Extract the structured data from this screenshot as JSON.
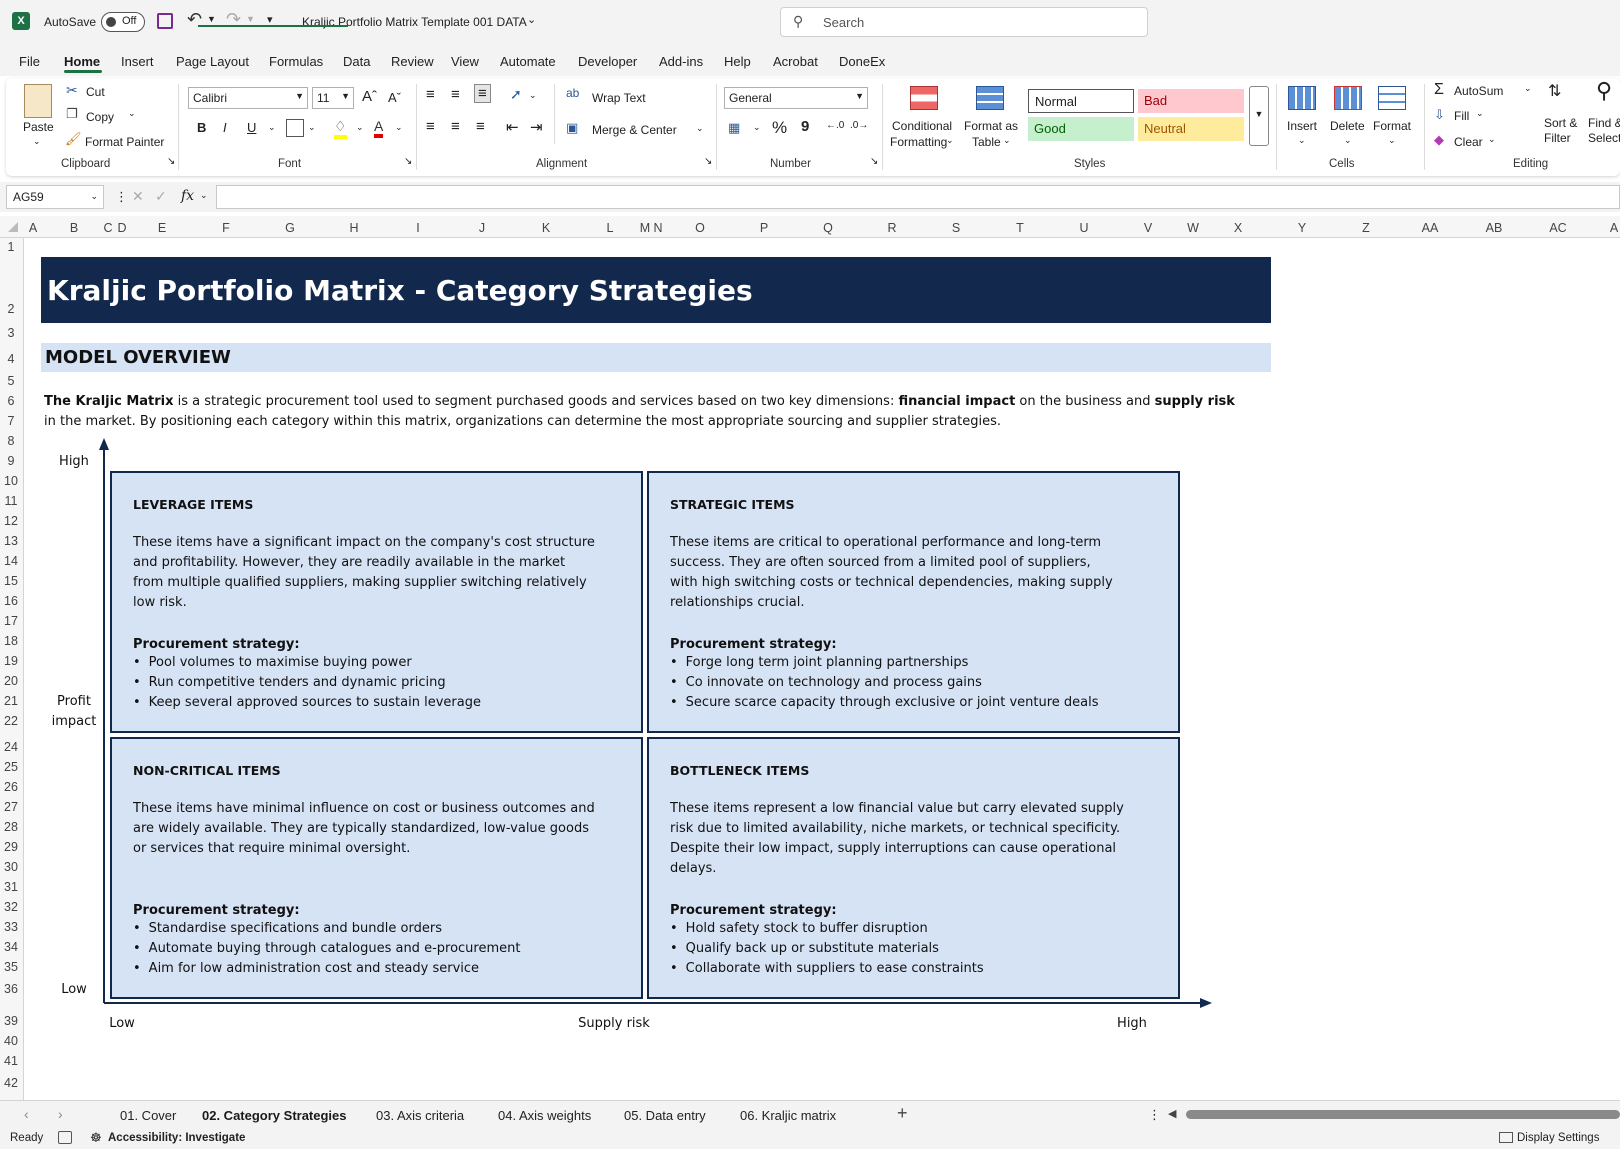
{
  "titlebar": {
    "autosave_label": "AutoSave",
    "autosave_state": "Off",
    "filename": "Kraljic Portfolio Matrix Template 001 DATA",
    "search_placeholder": "Search"
  },
  "menu": [
    "File",
    "Home",
    "Insert",
    "Page Layout",
    "Formulas",
    "Data",
    "Review",
    "View",
    "Automate",
    "Developer",
    "Add-ins",
    "Help",
    "Acrobat",
    "DoneEx"
  ],
  "ribbon": {
    "clipboard": {
      "paste": "Paste",
      "cut": "Cut",
      "copy": "Copy",
      "format_painter": "Format Painter",
      "label": "Clipboard"
    },
    "font": {
      "name": "Calibri",
      "size": "11",
      "bold": "B",
      "italic": "I",
      "underline": "U",
      "label": "Font"
    },
    "alignment": {
      "wrap": "Wrap Text",
      "merge": "Merge & Center",
      "label": "Alignment"
    },
    "number": {
      "format": "General",
      "percent": "%",
      "comma": "9",
      "label": "Number"
    },
    "styles": {
      "conditional": "Conditional",
      "conditional2": "Formatting",
      "format_table": "Format as",
      "format_table2": "Table",
      "normal": "Normal",
      "bad": "Bad",
      "good": "Good",
      "neutral": "Neutral",
      "label": "Styles"
    },
    "cells": {
      "insert": "Insert",
      "delete": "Delete",
      "format": "Format",
      "label": "Cells"
    },
    "editing": {
      "autosum": "AutoSum",
      "fill": "Fill",
      "clear": "Clear",
      "sort": "Sort &",
      "sort2": "Filter",
      "find": "Find &",
      "find2": "Select",
      "label": "Editing"
    }
  },
  "formula": {
    "namebox": "AG59",
    "fx": "fx"
  },
  "columns": [
    "A",
    "B",
    "C",
    "D",
    "E",
    "F",
    "G",
    "H",
    "I",
    "J",
    "K",
    "L",
    "M",
    "N",
    "O",
    "P",
    "Q",
    "R",
    "S",
    "T",
    "U",
    "V",
    "W",
    "X",
    "Y",
    "Z",
    "AA",
    "AB",
    "AC",
    "A"
  ],
  "rows": [
    "1",
    "2",
    "3",
    "4",
    "5",
    "6",
    "7",
    "8",
    "9",
    "10",
    "11",
    "12",
    "13",
    "14",
    "15",
    "16",
    "17",
    "18",
    "19",
    "20",
    "21",
    "22",
    "24",
    "25",
    "26",
    "27",
    "28",
    "29",
    "30",
    "31",
    "32",
    "33",
    "34",
    "35",
    "36",
    "39",
    "40",
    "41",
    "42"
  ],
  "sheet": {
    "title": "Kraljic Portfolio Matrix - Category Strategies",
    "overview_heading": "MODEL OVERVIEW",
    "intro1_a": "The Kraljic Matrix",
    "intro1_b": " is a strategic procurement tool used to segment purchased goods and services based on two key dimensions: ",
    "intro1_c": "financial impact",
    "intro1_d": " on the business and ",
    "intro1_e": "supply risk",
    "intro2": "in the market. By positioning each category within this matrix, organizations can determine the most appropriate sourcing and supplier strategies.",
    "y_high": "High",
    "y_label1": "Profit",
    "y_label2": "impact",
    "y_low": "Low",
    "x_low": "Low",
    "x_label": "Supply risk",
    "x_high": "High",
    "quadrants": {
      "leverage": {
        "title": "LEVERAGE ITEMS",
        "desc": [
          "These items have a significant impact on the company's cost structure",
          "and profitability. However, they are readily available in the market",
          "from multiple qualified suppliers, making supplier switching relatively",
          "low risk."
        ],
        "strategy_label": "Procurement strategy:",
        "bullets": [
          "Pool volumes to maximise buying power",
          "Run competitive tenders and dynamic pricing",
          "Keep several approved sources to sustain leverage"
        ]
      },
      "strategic": {
        "title": "STRATEGIC ITEMS",
        "desc": [
          "These items are critical to operational performance and long-term",
          "success. They are often sourced from a limited pool of suppliers,",
          "with high switching costs or technical dependencies, making supply",
          "relationships crucial."
        ],
        "strategy_label": "Procurement strategy:",
        "bullets": [
          "Forge long term joint planning partnerships",
          "Co innovate on technology and process gains",
          "Secure scarce capacity through exclusive or joint venture deals"
        ]
      },
      "noncritical": {
        "title": "NON-CRITICAL ITEMS",
        "desc": [
          "These items have minimal influence on cost or business outcomes and",
          "are widely available. They are typically standardized, low-value goods",
          "or services that require minimal oversight."
        ],
        "strategy_label": "Procurement strategy:",
        "bullets": [
          "Standardise specifications and bundle orders",
          "Automate buying through catalogues and e-procurement",
          "Aim for low administration cost and steady service"
        ]
      },
      "bottleneck": {
        "title": "BOTTLENECK ITEMS",
        "desc": [
          "These items represent a low financial value but carry elevated supply",
          "risk due to limited availability, niche markets, or technical specificity.",
          "Despite their low impact, supply interruptions can cause operational",
          "delays."
        ],
        "strategy_label": "Procurement strategy:",
        "bullets": [
          "Hold safety stock to buffer disruption",
          "Qualify back up or substitute materials",
          "Collaborate with suppliers to ease constraints"
        ]
      }
    }
  },
  "sheet_tabs": [
    "01. Cover",
    "02. Category Strategies",
    "03. Axis criteria",
    "04. Axis weights",
    "05. Data entry",
    "06. Kraljic matrix"
  ],
  "status": {
    "ready": "Ready",
    "accessibility": "Accessibility: Investigate",
    "display": "Display Settings"
  },
  "colors": {
    "title_band": "#12284c",
    "quad_fill": "#d6e3f5",
    "accent_green": "#1e7145"
  }
}
